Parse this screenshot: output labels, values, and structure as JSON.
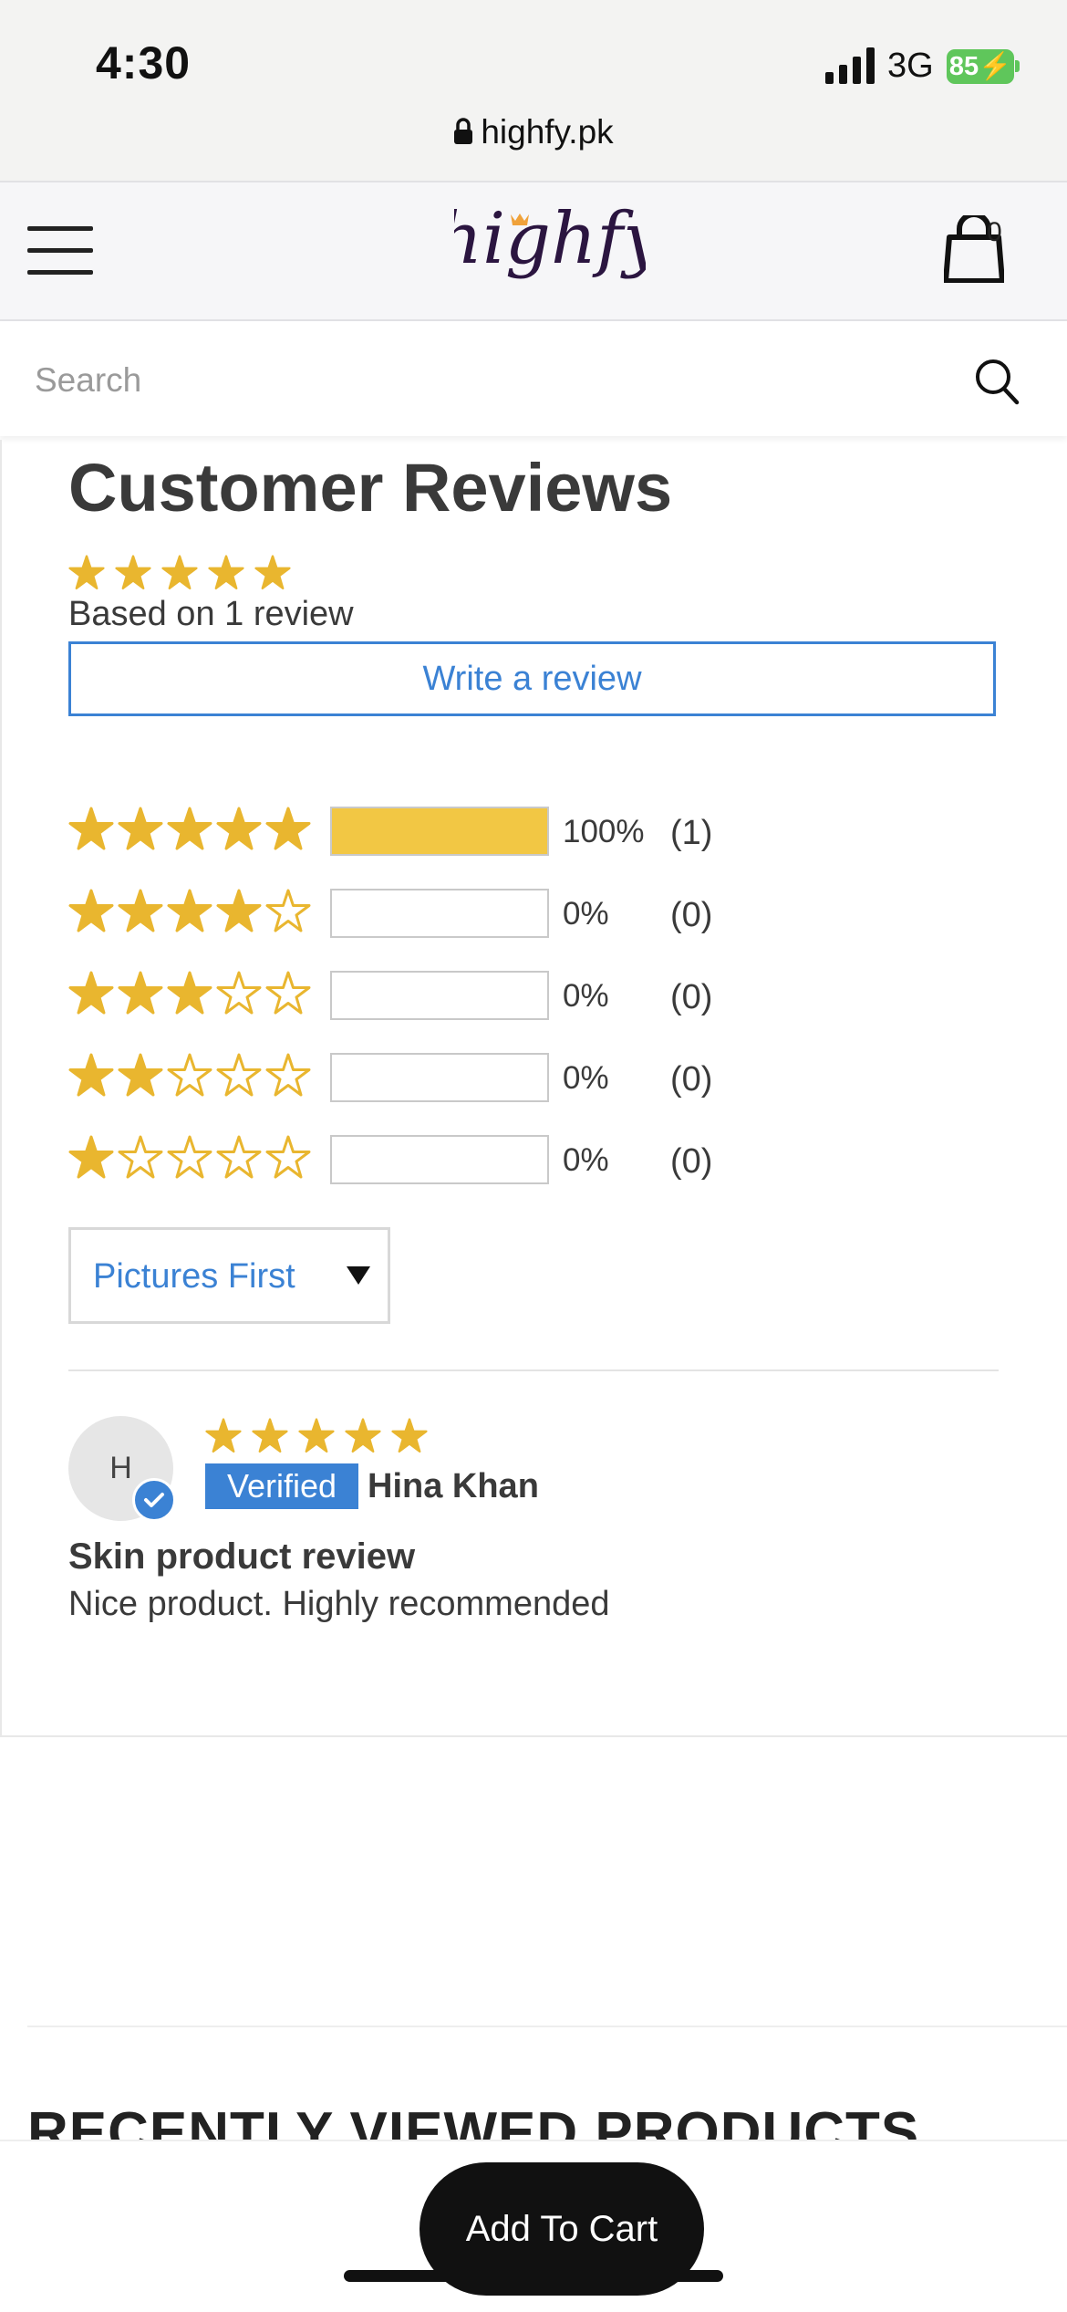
{
  "status_bar": {
    "time": "4:30",
    "network": "3G",
    "battery": "85"
  },
  "browser": {
    "url": "highfy.pk"
  },
  "header": {
    "logo_text": "highfy",
    "cart_count": "0"
  },
  "search": {
    "placeholder": "Search"
  },
  "reviews": {
    "title": "Customer Reviews",
    "average_rating": 5,
    "based_on": "Based on 1 review",
    "write_button": "Write a review",
    "histogram": [
      {
        "stars": 5,
        "fill": 1.0,
        "percent": "100%",
        "count": "(1)"
      },
      {
        "stars": 4,
        "fill": 0.0,
        "percent": "0%",
        "count": "(0)"
      },
      {
        "stars": 3,
        "fill": 0.0,
        "percent": "0%",
        "count": "(0)"
      },
      {
        "stars": 2,
        "fill": 0.0,
        "percent": "0%",
        "count": "(0)"
      },
      {
        "stars": 1,
        "fill": 0.0,
        "percent": "0%",
        "count": "(0)"
      }
    ],
    "sort": {
      "selected": "Pictures First"
    },
    "items": [
      {
        "avatar_initial": "H",
        "rating": 5,
        "badge": "Verified",
        "author": "Hina Khan",
        "title": "Skin product review",
        "body": "Nice product. Highly recommended"
      }
    ]
  },
  "recently_viewed": {
    "heading": "RECENTLY VIEWED PRODUCTS"
  },
  "actions": {
    "add_to_cart": "Add To Cart"
  },
  "colors": {
    "star": "#e9b62f",
    "accent": "#3b82d4",
    "bar_fill": "#f2c744"
  }
}
